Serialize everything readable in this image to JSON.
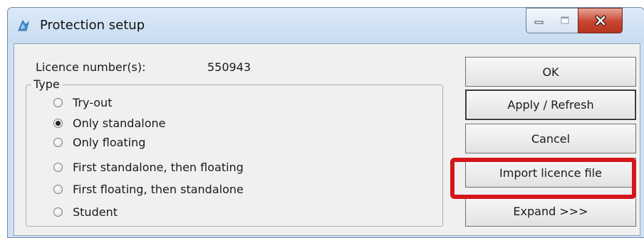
{
  "window": {
    "title": "Protection setup"
  },
  "licence": {
    "label": "Licence number(s):",
    "value": "550943"
  },
  "type_group": {
    "legend": "Type",
    "options": [
      {
        "label": "Try-out",
        "checked": false
      },
      {
        "label": "Only standalone",
        "checked": true
      },
      {
        "label": "Only floating",
        "checked": false
      },
      {
        "label": "First standalone, then floating",
        "checked": false
      },
      {
        "label": "First floating, then standalone",
        "checked": false
      },
      {
        "label": "Student",
        "checked": false
      }
    ]
  },
  "buttons": {
    "ok": "OK",
    "apply": "Apply / Refresh",
    "cancel": "Cancel",
    "import": "Import licence file",
    "expand": "Expand >>>"
  },
  "icons": {
    "app": "app-logo-icon",
    "minimize": "minimize-icon",
    "maximize": "maximize-icon",
    "close": "close-icon"
  },
  "colors": {
    "highlight": "#d4161b",
    "close_button": "#c8452f"
  }
}
